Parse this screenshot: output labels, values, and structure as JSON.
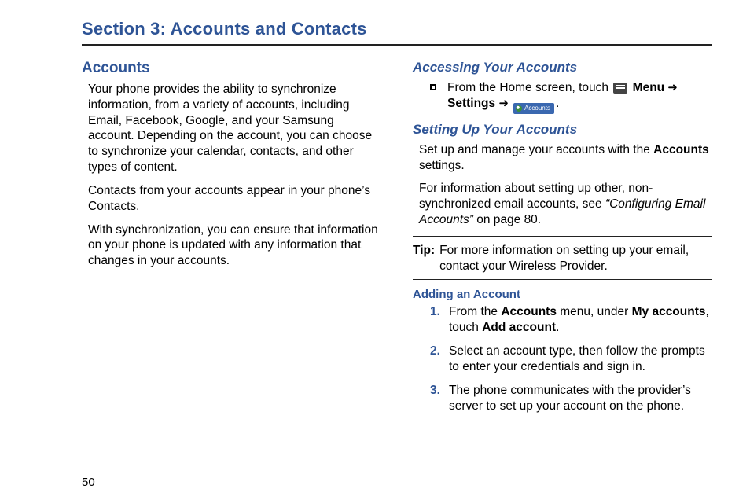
{
  "pageNumber": "50",
  "sectionTitle": "Section 3: Accounts and Contacts",
  "accounts": {
    "heading": "Accounts",
    "p1": "Your phone provides the ability to synchronize information, from a variety of accounts, including Email, Facebook, Google, and your Samsung account. Depending on the account, you can choose to synchronize your calendar, contacts, and other types of content.",
    "p2": "Contacts from your accounts appear in your phone’s Contacts.",
    "p3": "With synchronization, you can ensure that information on your phone is updated with any information that changes in your accounts."
  },
  "accessing": {
    "heading": "Accessing Your Accounts",
    "lead": "From the Home screen, touch ",
    "menuLabel": "Menu",
    "arrow1": " ➜ ",
    "settingsLabel": "Settings",
    "arrow2": " ➜ ",
    "accountsChip": "Accounts",
    "period": "."
  },
  "setup": {
    "heading": "Setting Up Your Accounts",
    "p1a": "Set up and manage your accounts with the ",
    "p1bold": "Accounts",
    "p1b": " settings.",
    "p2a": "For information about setting up other, non-synchronized email accounts, see ",
    "p2xref": "“Configuring Email Accounts”",
    "p2b": " on page 80."
  },
  "tip": {
    "label": "Tip:",
    "text": "For more information on setting up your email, contact your Wireless Provider."
  },
  "adding": {
    "heading": "Adding an Account",
    "s1a": "From the ",
    "s1b": "Accounts",
    "s1c": " menu, under ",
    "s1d": "My accounts",
    "s1e": ", touch ",
    "s1f": "Add account",
    "s1g": ".",
    "s2": "Select an account type, then follow the prompts to enter your credentials and sign in.",
    "s3": "The phone communicates with the provider’s server to set up your account on the phone."
  }
}
